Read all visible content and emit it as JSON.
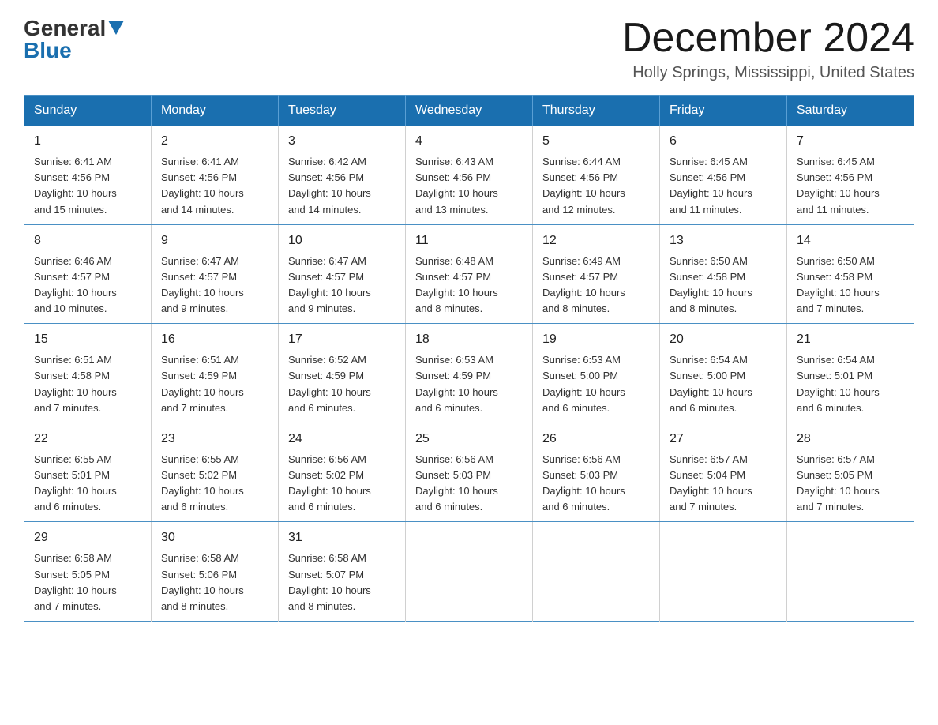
{
  "header": {
    "logo_general": "General",
    "logo_blue": "Blue",
    "month_title": "December 2024",
    "location": "Holly Springs, Mississippi, United States"
  },
  "weekdays": [
    "Sunday",
    "Monday",
    "Tuesday",
    "Wednesday",
    "Thursday",
    "Friday",
    "Saturday"
  ],
  "weeks": [
    [
      {
        "day": "1",
        "sunrise": "6:41 AM",
        "sunset": "4:56 PM",
        "daylight": "10 hours and 15 minutes."
      },
      {
        "day": "2",
        "sunrise": "6:41 AM",
        "sunset": "4:56 PM",
        "daylight": "10 hours and 14 minutes."
      },
      {
        "day": "3",
        "sunrise": "6:42 AM",
        "sunset": "4:56 PM",
        "daylight": "10 hours and 14 minutes."
      },
      {
        "day": "4",
        "sunrise": "6:43 AM",
        "sunset": "4:56 PM",
        "daylight": "10 hours and 13 minutes."
      },
      {
        "day": "5",
        "sunrise": "6:44 AM",
        "sunset": "4:56 PM",
        "daylight": "10 hours and 12 minutes."
      },
      {
        "day": "6",
        "sunrise": "6:45 AM",
        "sunset": "4:56 PM",
        "daylight": "10 hours and 11 minutes."
      },
      {
        "day": "7",
        "sunrise": "6:45 AM",
        "sunset": "4:56 PM",
        "daylight": "10 hours and 11 minutes."
      }
    ],
    [
      {
        "day": "8",
        "sunrise": "6:46 AM",
        "sunset": "4:57 PM",
        "daylight": "10 hours and 10 minutes."
      },
      {
        "day": "9",
        "sunrise": "6:47 AM",
        "sunset": "4:57 PM",
        "daylight": "10 hours and 9 minutes."
      },
      {
        "day": "10",
        "sunrise": "6:47 AM",
        "sunset": "4:57 PM",
        "daylight": "10 hours and 9 minutes."
      },
      {
        "day": "11",
        "sunrise": "6:48 AM",
        "sunset": "4:57 PM",
        "daylight": "10 hours and 8 minutes."
      },
      {
        "day": "12",
        "sunrise": "6:49 AM",
        "sunset": "4:57 PM",
        "daylight": "10 hours and 8 minutes."
      },
      {
        "day": "13",
        "sunrise": "6:50 AM",
        "sunset": "4:58 PM",
        "daylight": "10 hours and 8 minutes."
      },
      {
        "day": "14",
        "sunrise": "6:50 AM",
        "sunset": "4:58 PM",
        "daylight": "10 hours and 7 minutes."
      }
    ],
    [
      {
        "day": "15",
        "sunrise": "6:51 AM",
        "sunset": "4:58 PM",
        "daylight": "10 hours and 7 minutes."
      },
      {
        "day": "16",
        "sunrise": "6:51 AM",
        "sunset": "4:59 PM",
        "daylight": "10 hours and 7 minutes."
      },
      {
        "day": "17",
        "sunrise": "6:52 AM",
        "sunset": "4:59 PM",
        "daylight": "10 hours and 6 minutes."
      },
      {
        "day": "18",
        "sunrise": "6:53 AM",
        "sunset": "4:59 PM",
        "daylight": "10 hours and 6 minutes."
      },
      {
        "day": "19",
        "sunrise": "6:53 AM",
        "sunset": "5:00 PM",
        "daylight": "10 hours and 6 minutes."
      },
      {
        "day": "20",
        "sunrise": "6:54 AM",
        "sunset": "5:00 PM",
        "daylight": "10 hours and 6 minutes."
      },
      {
        "day": "21",
        "sunrise": "6:54 AM",
        "sunset": "5:01 PM",
        "daylight": "10 hours and 6 minutes."
      }
    ],
    [
      {
        "day": "22",
        "sunrise": "6:55 AM",
        "sunset": "5:01 PM",
        "daylight": "10 hours and 6 minutes."
      },
      {
        "day": "23",
        "sunrise": "6:55 AM",
        "sunset": "5:02 PM",
        "daylight": "10 hours and 6 minutes."
      },
      {
        "day": "24",
        "sunrise": "6:56 AM",
        "sunset": "5:02 PM",
        "daylight": "10 hours and 6 minutes."
      },
      {
        "day": "25",
        "sunrise": "6:56 AM",
        "sunset": "5:03 PM",
        "daylight": "10 hours and 6 minutes."
      },
      {
        "day": "26",
        "sunrise": "6:56 AM",
        "sunset": "5:03 PM",
        "daylight": "10 hours and 6 minutes."
      },
      {
        "day": "27",
        "sunrise": "6:57 AM",
        "sunset": "5:04 PM",
        "daylight": "10 hours and 7 minutes."
      },
      {
        "day": "28",
        "sunrise": "6:57 AM",
        "sunset": "5:05 PM",
        "daylight": "10 hours and 7 minutes."
      }
    ],
    [
      {
        "day": "29",
        "sunrise": "6:58 AM",
        "sunset": "5:05 PM",
        "daylight": "10 hours and 7 minutes."
      },
      {
        "day": "30",
        "sunrise": "6:58 AM",
        "sunset": "5:06 PM",
        "daylight": "10 hours and 8 minutes."
      },
      {
        "day": "31",
        "sunrise": "6:58 AM",
        "sunset": "5:07 PM",
        "daylight": "10 hours and 8 minutes."
      },
      null,
      null,
      null,
      null
    ]
  ],
  "labels": {
    "sunrise": "Sunrise:",
    "sunset": "Sunset:",
    "daylight": "Daylight:"
  }
}
